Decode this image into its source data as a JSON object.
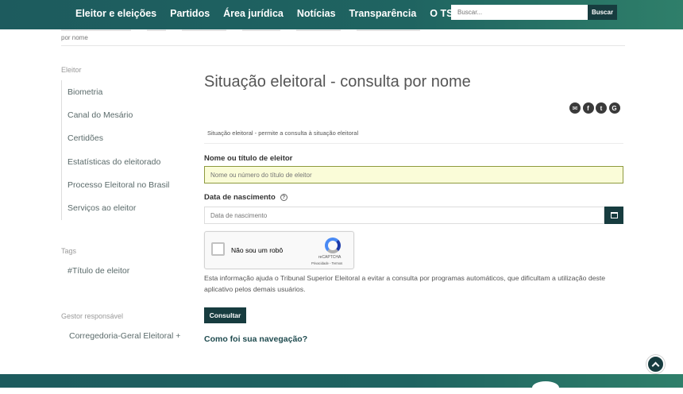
{
  "nav": {
    "items": [
      "Eleitor e eleições",
      "Partidos",
      "Área jurídica",
      "Notícias",
      "Transparência",
      "O TSE"
    ],
    "search_placeholder": "Buscar...",
    "search_button": "Buscar"
  },
  "breadcrumb": {
    "last": "por nome"
  },
  "sidebar": {
    "heading": "Eleitor",
    "items": [
      "Biometria",
      "Canal do Mesário",
      "Certidões",
      "Estatísticas do eleitorado",
      "Processo Eleitoral no Brasil",
      "Serviços ao eleitor"
    ],
    "tags_heading": "Tags",
    "tag": "#Título de eleitor",
    "gestor_heading": "Gestor responsável",
    "gestor": "Corregedoria-Geral Eleitoral +"
  },
  "main": {
    "title": "Situação eleitoral - consulta por nome",
    "description": "Situação eleitoral - permite a consulta à situação eleitoral",
    "name_label": "Nome ou título de eleitor",
    "name_placeholder": "Nome ou número do título de eleitor",
    "birth_label": "Data de nascimento",
    "help_glyph": "?",
    "birth_placeholder": "Data de nascimento",
    "captcha_label": "Não sou um robô",
    "captcha_brand": "reCAPTCHA",
    "captcha_terms": "Privacidade - Termos",
    "info": "Esta informação ajuda o Tribunal Superior Eleitoral a evitar a consulta por programas automáticos, que dificultam a utilização deste aplicativo pelos demais usuários.",
    "submit": "Consultar",
    "feedback": "Como foi sua navegação?"
  },
  "share": {
    "icons": [
      "email-icon",
      "facebook-icon",
      "twitter-icon",
      "google-plus-icon"
    ],
    "glyphs": [
      "✉",
      "f",
      "t",
      "G"
    ]
  },
  "colors": {
    "header": "#1f6461",
    "button": "#173c3f",
    "field_highlight": "#fafcd8"
  }
}
